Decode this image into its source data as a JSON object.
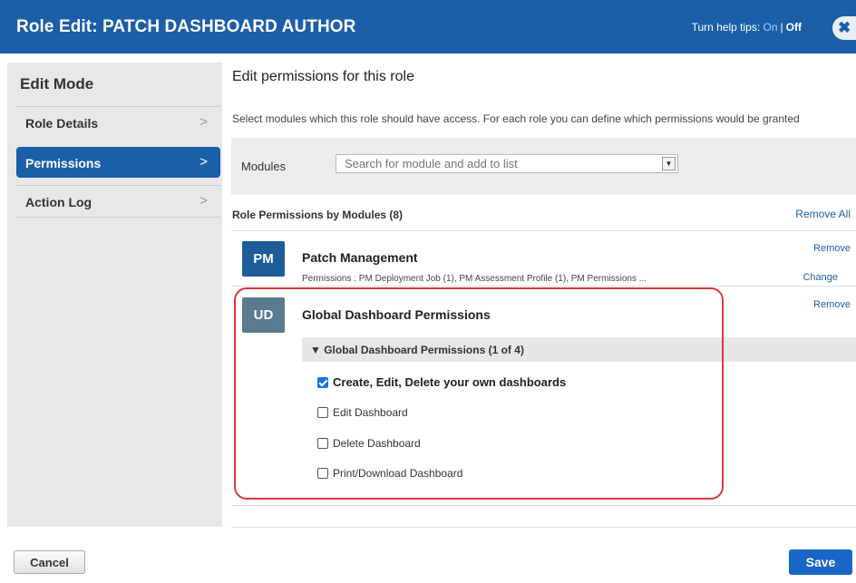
{
  "window": {
    "title": "Role Edit: PATCH DASHBOARD AUTHOR",
    "help_tips_label": "Turn help tips:",
    "help_on": "On",
    "help_separator": "|",
    "help_off": "Off",
    "close_icon": "close-icon"
  },
  "sidebar": {
    "heading": "Edit Mode",
    "items": [
      {
        "label": "Role Details",
        "active": false
      },
      {
        "label": "Permissions",
        "active": true
      },
      {
        "label": "Action Log",
        "active": false
      }
    ]
  },
  "main": {
    "title": "Edit permissions for this role",
    "description": "Select modules which this role should have access. For each role you can define which permissions would be granted",
    "modules_label": "Modules",
    "modules_placeholder": "Search for module and add to list",
    "role_permissions_header": "Role Permissions by Modules (8)",
    "remove_all": "Remove All"
  },
  "modules": [
    {
      "badge": "PM",
      "badge_color": "#1d5c99",
      "name": "Patch Management",
      "permissions_text": "Permissions : PM Deployment Job (1), PM Assessment Profile (1),  PM Permissions ...",
      "remove": "Remove",
      "change": "Change"
    },
    {
      "badge": "UD",
      "badge_color": "#5a7a90",
      "name": "Global Dashboard Permissions",
      "remove": "Remove",
      "group_title": "Global Dashboard Permissions (1 of 4)",
      "permissions": [
        {
          "label": "Create, Edit, Delete your own dashboards",
          "checked": true
        },
        {
          "label": "Edit Dashboard",
          "checked": false
        },
        {
          "label": "Delete Dashboard",
          "checked": false
        },
        {
          "label": "Print/Download Dashboard",
          "checked": false
        }
      ]
    }
  ],
  "footer": {
    "cancel": "Cancel",
    "save": "Save"
  },
  "colors": {
    "header_blue": "#1b5fa8",
    "highlight_red": "#d9383f"
  }
}
